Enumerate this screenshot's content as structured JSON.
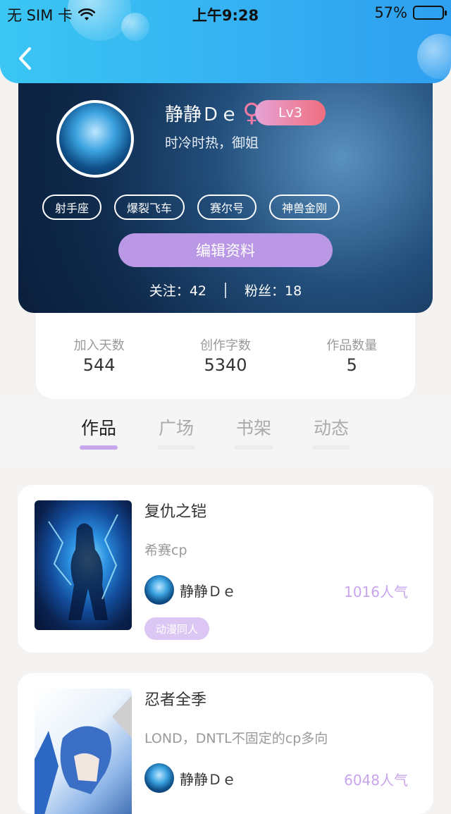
{
  "status_bar": {
    "carrier": "无 SIM 卡",
    "time": "上午9:28",
    "battery_pct_text": "57%",
    "battery_level": 0.57
  },
  "profile": {
    "name": "静静Ｄｅ",
    "gender_symbol": "♀",
    "level": "Lv3",
    "bio": "时冷时热，御姐",
    "tags": [
      "射手座",
      "爆裂飞车",
      "赛尔号",
      "神兽金刚"
    ],
    "edit_button": "编辑资料",
    "following_label": "关注：",
    "following_count": "42",
    "fans_label": "粉丝：",
    "fans_count": "18"
  },
  "stats": [
    {
      "label": "加入天数",
      "value": "544"
    },
    {
      "label": "创作字数",
      "value": "5340"
    },
    {
      "label": "作品数量",
      "value": "5"
    }
  ],
  "tabs": [
    {
      "label": "作品",
      "active": true
    },
    {
      "label": "广场",
      "active": false
    },
    {
      "label": "书架",
      "active": false
    },
    {
      "label": "动态",
      "active": false
    }
  ],
  "works": [
    {
      "title": "复仇之铠",
      "desc": "希赛cp",
      "author": "静静Ｄｅ",
      "popularity": "1016人气",
      "tag": "动漫同人"
    },
    {
      "title": "忍者全季",
      "desc": "LOND，DNTL不固定的cp多向",
      "author": "静静Ｄｅ",
      "popularity": "6048人气",
      "tag": ""
    }
  ],
  "colors": {
    "header_gradient_start": "#3bc6f3",
    "header_gradient_end": "#2f9ff0",
    "accent_purple": "#bb98e5",
    "level_badge_start": "#e6a3d6",
    "level_badge_end": "#f06e7f",
    "popularity_text": "#c8a4ec"
  },
  "icons": {
    "back": "chevron-left-icon",
    "wifi": "wifi-icon",
    "battery": "battery-icon"
  }
}
